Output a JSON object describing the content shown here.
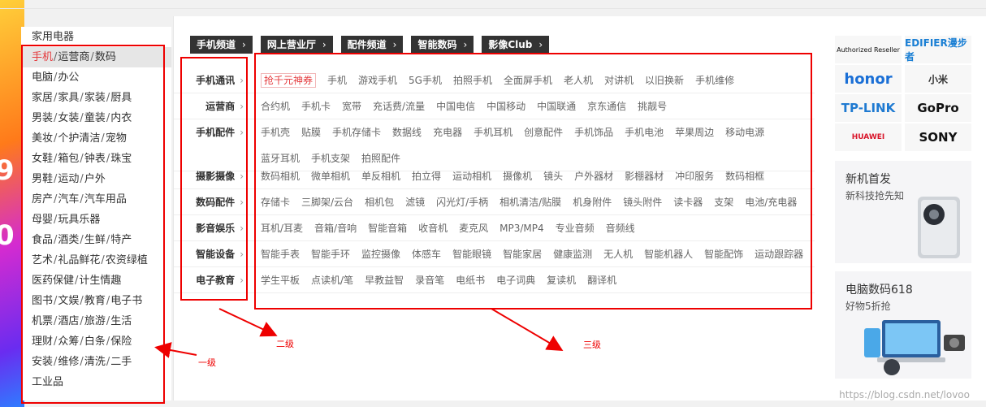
{
  "sidebar": {
    "items": [
      {
        "parts": [
          "家用电器"
        ]
      },
      {
        "parts": [
          "手机",
          "运营商",
          "数码"
        ],
        "active": true
      },
      {
        "parts": [
          "电脑",
          "办公"
        ]
      },
      {
        "parts": [
          "家居",
          "家具",
          "家装",
          "厨具"
        ]
      },
      {
        "parts": [
          "男装",
          "女装",
          "童装",
          "内衣"
        ]
      },
      {
        "parts": [
          "美妆",
          "个护清洁",
          "宠物"
        ]
      },
      {
        "parts": [
          "女鞋",
          "箱包",
          "钟表",
          "珠宝"
        ]
      },
      {
        "parts": [
          "男鞋",
          "运动",
          "户外"
        ]
      },
      {
        "parts": [
          "房产",
          "汽车",
          "汽车用品"
        ]
      },
      {
        "parts": [
          "母婴",
          "玩具乐器"
        ]
      },
      {
        "parts": [
          "食品",
          "酒类",
          "生鲜",
          "特产"
        ]
      },
      {
        "parts": [
          "艺术",
          "礼品鲜花",
          "农资绿植"
        ]
      },
      {
        "parts": [
          "医药保健",
          "计生情趣"
        ]
      },
      {
        "parts": [
          "图书",
          "文娱",
          "教育",
          "电子书"
        ]
      },
      {
        "parts": [
          "机票",
          "酒店",
          "旅游",
          "生活"
        ]
      },
      {
        "parts": [
          "理财",
          "众筹",
          "白条",
          "保险"
        ]
      },
      {
        "parts": [
          "安装",
          "维修",
          "清洗",
          "二手"
        ]
      },
      {
        "parts": [
          "工业品"
        ]
      }
    ]
  },
  "channels": [
    "手机频道",
    "网上营业厅",
    "配件频道",
    "智能数码",
    "影像Club"
  ],
  "categories": [
    {
      "title": "手机通讯",
      "items": [
        "抢千元神券",
        "手机",
        "游戏手机",
        "5G手机",
        "拍照手机",
        "全面屏手机",
        "老人机",
        "对讲机",
        "以旧换新",
        "手机维修"
      ],
      "promo": 0
    },
    {
      "title": "运营商",
      "items": [
        "合约机",
        "手机卡",
        "宽带",
        "充话费/流量",
        "中国电信",
        "中国移动",
        "中国联通",
        "京东通信",
        "挑靓号"
      ]
    },
    {
      "title": "手机配件",
      "items": [
        "手机壳",
        "贴膜",
        "手机存储卡",
        "数据线",
        "充电器",
        "手机耳机",
        "创意配件",
        "手机饰品",
        "手机电池",
        "苹果周边",
        "移动电源",
        "蓝牙耳机",
        "手机支架",
        "拍照配件"
      ]
    },
    {
      "title": "摄影摄像",
      "items": [
        "数码相机",
        "微单相机",
        "单反相机",
        "拍立得",
        "运动相机",
        "摄像机",
        "镜头",
        "户外器材",
        "影棚器材",
        "冲印服务",
        "数码相框"
      ]
    },
    {
      "title": "数码配件",
      "items": [
        "存储卡",
        "三脚架/云台",
        "相机包",
        "滤镜",
        "闪光灯/手柄",
        "相机清洁/贴膜",
        "机身附件",
        "镜头附件",
        "读卡器",
        "支架",
        "电池/充电器"
      ]
    },
    {
      "title": "影音娱乐",
      "items": [
        "耳机/耳麦",
        "音箱/音响",
        "智能音箱",
        "收音机",
        "麦克风",
        "MP3/MP4",
        "专业音频",
        "音频线"
      ]
    },
    {
      "title": "智能设备",
      "items": [
        "智能手表",
        "智能手环",
        "监控摄像",
        "体感车",
        "智能眼镜",
        "智能家居",
        "健康监测",
        "无人机",
        "智能机器人",
        "智能配饰",
        "运动跟踪器"
      ]
    },
    {
      "title": "电子教育",
      "items": [
        "学生平板",
        "点读机/笔",
        "早教益智",
        "录音笔",
        "电纸书",
        "电子词典",
        "复读机",
        "翻译机"
      ]
    }
  ],
  "brands": [
    {
      "name": "apple",
      "text": "Authorized Reseller",
      "color": "#111111"
    },
    {
      "name": "edifier",
      "text": "EDIFIER漫步者",
      "color": "#1a7fd4"
    },
    {
      "name": "honor",
      "text": "honor",
      "color": "#1a6fd6"
    },
    {
      "name": "mi",
      "text": "小米",
      "color": "#333333"
    },
    {
      "name": "tplink",
      "text": "TP-LINK",
      "color": "#1f7ad1"
    },
    {
      "name": "gopro",
      "text": "GoPro",
      "color": "#111111"
    },
    {
      "name": "huawei",
      "text": "HUAWEI",
      "color": "#d9162b"
    },
    {
      "name": "sony",
      "text": "SONY",
      "color": "#111111"
    }
  ],
  "promos": [
    {
      "title": "新机首发",
      "subtitle": "新科技抢先知"
    },
    {
      "title": "电脑数码618",
      "subtitle": "好物5折抢"
    }
  ],
  "annotations": {
    "level1": "一级",
    "level2": "二级",
    "level3": "三级"
  },
  "watermark": "https://blog.csdn.net/lovoo"
}
